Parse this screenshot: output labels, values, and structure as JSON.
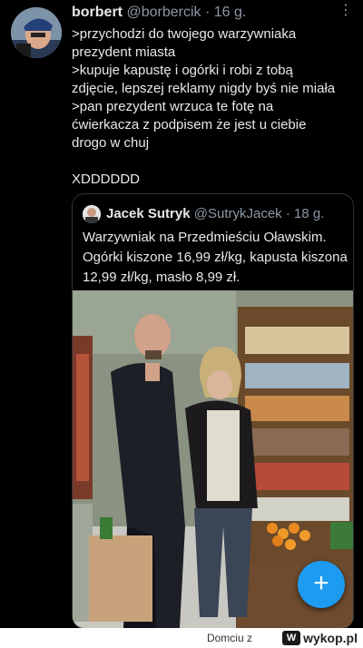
{
  "tweet": {
    "display_name": "borbert",
    "handle": "@borbercik",
    "separator": "·",
    "age": "16 g.",
    "text": ">przychodzi do twojego warzywniaka\nprezydent miasta\n>kupuje kapustę i ogórki i robi z tobą\nzdjęcie, lepszej reklamy nigdy byś nie miała\n>pan prezydent wrzuca te fotę na\nćwierkacza z podpisem że jest u ciebie\ndrogo w chuj\n\nXDDDDDD",
    "more_icon": "ellipsis-vertical-icon"
  },
  "quoted": {
    "display_name": "Jacek Sutryk",
    "handle": "@SutrykJacek",
    "separator": "·",
    "age": "18 g.",
    "text": "Warzywniak na Przedmieściu Oławskim. Ogórki kiszone 16,99 zł/kg, kapusta kiszona 12,99 zł/kg, masło 8,99 zł."
  },
  "fab": {
    "icon": "plus-icon",
    "label": "+"
  },
  "footer": {
    "author": "Domciu",
    "separator": "z",
    "brand": "wykop.pl",
    "brand_mark": "W"
  },
  "colors": {
    "accent": "#1d9bf0",
    "background": "#000000",
    "text": "#e7e9ea",
    "muted": "#8b98a5"
  }
}
